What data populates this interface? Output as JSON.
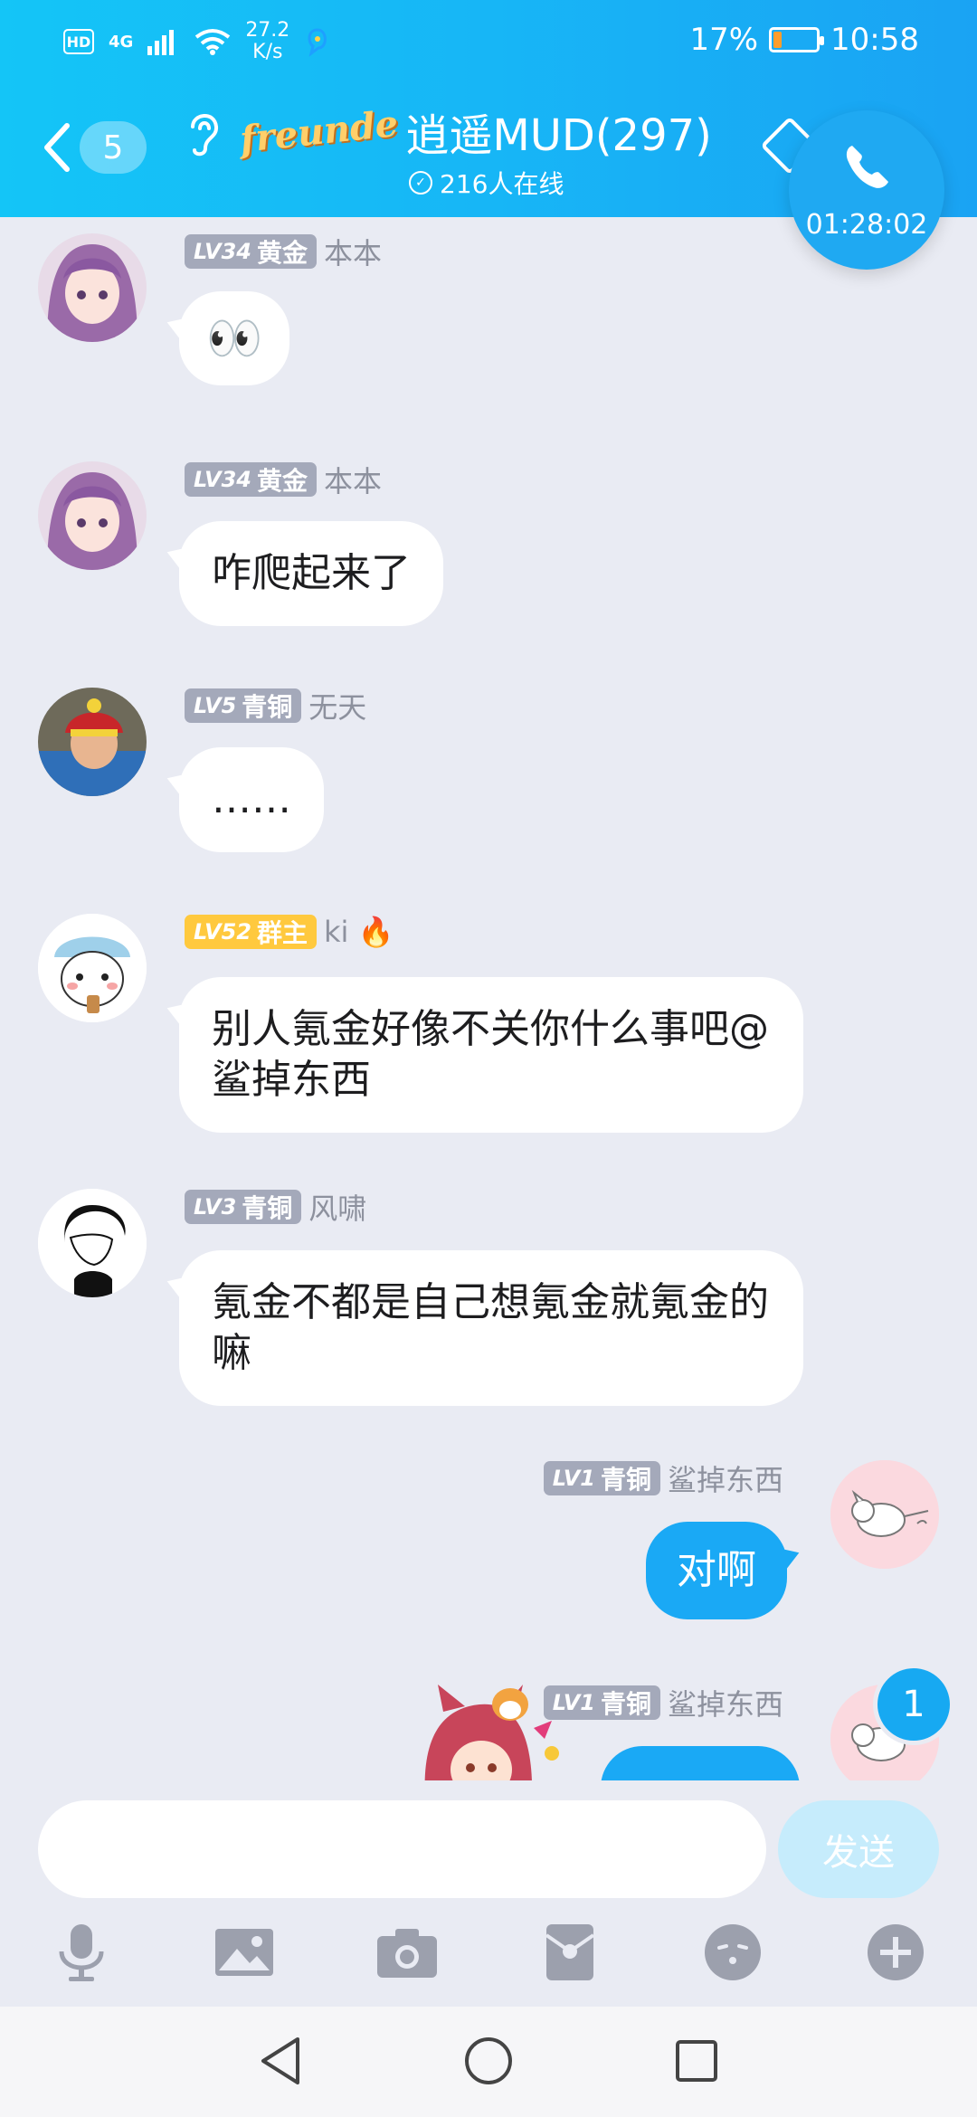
{
  "status_bar": {
    "hd": "HD",
    "network": "4G",
    "speed_value": "27.2",
    "speed_unit": "K/s",
    "battery": "17%",
    "battery_level": 0.17,
    "time": "10:58"
  },
  "header": {
    "back_count": "5",
    "logo_text": "freunde",
    "title": "逍遥MUD(297)",
    "online": "216人在线"
  },
  "call": {
    "timer": "01:28:02"
  },
  "messages": [
    {
      "level": "LV34",
      "rank": "黄金",
      "nick": "本本",
      "text": "👀",
      "side": "left"
    },
    {
      "level": "LV34",
      "rank": "黄金",
      "nick": "本本",
      "text": "咋爬起来了",
      "side": "left"
    },
    {
      "level": "LV5",
      "rank": "青铜",
      "nick": "无天",
      "text": "……",
      "side": "left"
    },
    {
      "level": "LV52",
      "rank": "群主",
      "nick": "ki 🔥",
      "text": "别人氪金好像不关你什么事吧@鲨掉东西",
      "side": "left"
    },
    {
      "level": "LV3",
      "rank": "青铜",
      "nick": "风啸",
      "text": "氪金不都是自己想氪金就氪金的嘛",
      "side": "left"
    },
    {
      "level": "LV1",
      "rank": "青铜",
      "nick": "鲨掉东西",
      "text": "对啊",
      "side": "right"
    },
    {
      "level": "LV1",
      "rank": "青铜",
      "nick": "鲨掉东西",
      "text": "",
      "side": "right"
    }
  ],
  "unread": "1",
  "input": {
    "placeholder": "",
    "send_label": "发送"
  },
  "tools": [
    "microphone-icon",
    "image-icon",
    "camera-icon",
    "red-packet-icon",
    "emoji-icon",
    "plus-icon"
  ],
  "colors": {
    "header_start": "#14c5f7",
    "header_end": "#1aa3f3",
    "background": "#e9ebf3",
    "my_bubble": "#1aa9f5",
    "owner_badge": "#ffc93e",
    "member_badge": "#a4a9ba"
  }
}
